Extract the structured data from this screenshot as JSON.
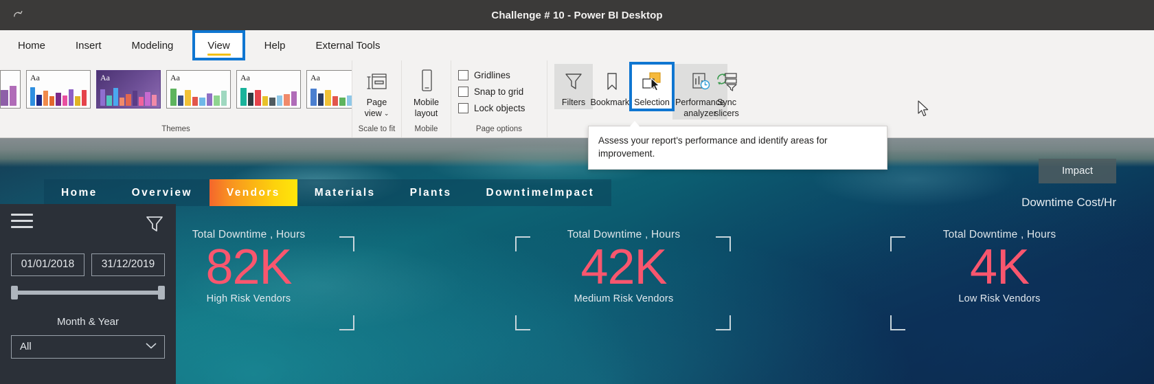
{
  "titlebar": {
    "title": "Challenge # 10 - Power BI Desktop",
    "quick_access": [
      {
        "name": "redo-icon",
        "glyph": "↷"
      }
    ]
  },
  "ribbon_tabs": {
    "items": [
      {
        "label": "Home",
        "selected": false
      },
      {
        "label": "Insert",
        "selected": false
      },
      {
        "label": "Modeling",
        "selected": false
      },
      {
        "label": "View",
        "selected": true
      },
      {
        "label": "Help",
        "selected": false
      },
      {
        "label": "External Tools",
        "selected": false
      }
    ],
    "selected_accent": "#0f76d1",
    "underline_color": "#f2c014"
  },
  "ribbon": {
    "groups": [
      {
        "label": "Themes"
      },
      {
        "label": "Scale to fit"
      },
      {
        "label": "Mobile"
      },
      {
        "label": "Page options"
      },
      {
        "label": ""
      },
      {
        "label": ""
      }
    ],
    "themes": {
      "label": "Themes",
      "aa_text": "Aa",
      "more_glyph": "⌄"
    },
    "scale_to_fit": {
      "group_label": "Scale to fit",
      "button_label_line1": "Page",
      "button_label_line2": "view",
      "dropdown_glyph": "⌄"
    },
    "mobile": {
      "group_label": "Mobile",
      "button_label_line1": "Mobile",
      "button_label_line2": "layout"
    },
    "page_options": {
      "group_label": "Page options",
      "checkboxes": [
        {
          "label": "Gridlines",
          "checked": false
        },
        {
          "label": "Snap to grid",
          "checked": false
        },
        {
          "label": "Lock objects",
          "checked": false
        }
      ]
    },
    "show_panes": {
      "buttons": [
        {
          "label": "Filters",
          "state": "hovered"
        },
        {
          "label": "Bookmarks",
          "state": "normal"
        },
        {
          "label": "Selection",
          "state": "selected"
        },
        {
          "label": "Performance analyzer",
          "line1": "Performance",
          "line2": "analyzer",
          "state": "hovered"
        }
      ]
    },
    "sync_slicers": {
      "line1": "Sync",
      "line2": "slicers"
    }
  },
  "tooltip": {
    "text": "Assess your report's performance and identify areas for improvement."
  },
  "report": {
    "nav": {
      "items": [
        {
          "label": "Home",
          "active": false
        },
        {
          "label": "Overview",
          "active": false
        },
        {
          "label": "Vendors",
          "active": true
        },
        {
          "label": "Materials",
          "active": false
        },
        {
          "label": "Plants",
          "active": false
        },
        {
          "label": "DowntimeImpact",
          "active": false
        }
      ],
      "active_gradient_start": "#f4662c",
      "active_gradient_end": "#ffe60a"
    },
    "slicer": {
      "menu_icon": "hamburger-icon",
      "filter_icon": "funnel-icon",
      "date_from": "01/01/2018",
      "date_to": "31/12/2019",
      "month_year_label": "Month & Year",
      "month_year_value": "All",
      "dropdown_glyph": "⌄"
    },
    "impact_tab": "Impact",
    "cost_label": "Downtime Cost/Hr",
    "kpi_value_color": "#f9566e",
    "kpis": [
      {
        "title": "Total Downtime , Hours",
        "value": "82K",
        "subtitle": "High Risk Vendors"
      },
      {
        "title": "Total Downtime , Hours",
        "value": "42K",
        "subtitle": "Medium Risk Vendors"
      },
      {
        "title": "Total Downtime , Hours",
        "value": "4K",
        "subtitle": "Low Risk Vendors"
      }
    ]
  }
}
